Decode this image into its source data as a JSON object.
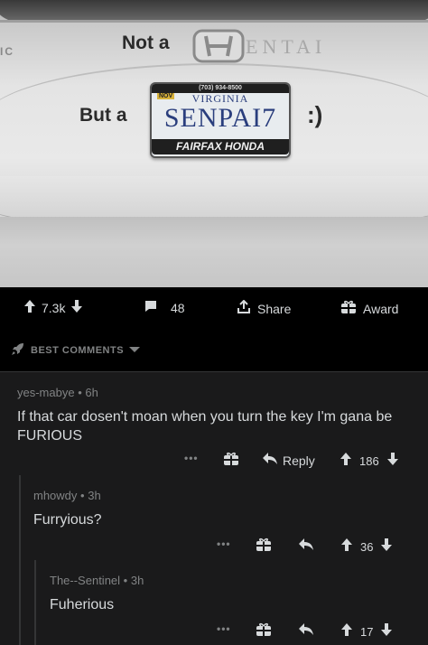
{
  "photo": {
    "badge_fragment": "IC",
    "sticker_top": "Not a",
    "model_letters": "ENTAI",
    "sticker_left": "But a",
    "plate_phone": "(703) 934-8500",
    "plate_state": "VIRGINIA",
    "plate_month": "NOV",
    "plate_number": "SENPAI7",
    "plate_dealer": "FAIRFAX HONDA",
    "smiley": ":)"
  },
  "post_actions": {
    "votes": "7.3k",
    "comments": "48",
    "share_label": "Share",
    "award_label": "Award"
  },
  "sort": {
    "label": "BEST COMMENTS"
  },
  "comments": [
    {
      "author": "yes-mabye",
      "age": "6h",
      "body": "If that car dosen't moan when you turn the key I'm gana be FURIOUS",
      "reply_label": "Reply",
      "votes": "186"
    },
    {
      "author": "mhowdy",
      "age": "3h",
      "body": "Furryious?",
      "votes": "36"
    },
    {
      "author": "The--Sentinel",
      "age": "3h",
      "body": "Fuherious",
      "votes": "17"
    }
  ],
  "more_label": "•••",
  "separator": "•",
  "colors": {
    "background": "#1a1a1b",
    "text": "#d7dadc",
    "meta": "#818384"
  }
}
